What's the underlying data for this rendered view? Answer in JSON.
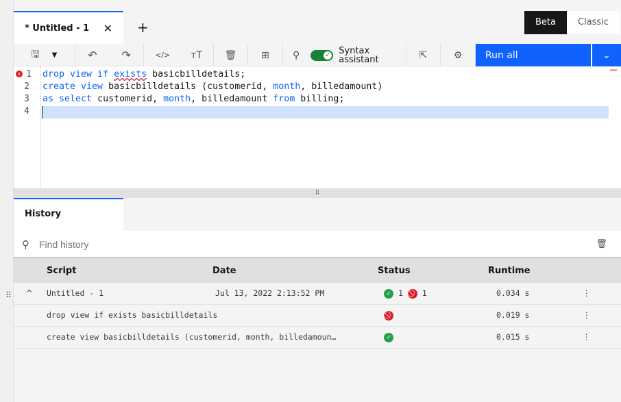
{
  "tabs": {
    "active": "* Untitled - 1"
  },
  "mode": {
    "beta": "Beta",
    "classic": "Classic"
  },
  "toolbar": {
    "syntax": "Syntax assistant",
    "run": "Run all"
  },
  "editor": {
    "lines": [
      "1",
      "2",
      "3",
      "4"
    ]
  },
  "history": {
    "tab": "History",
    "search_placeholder": "Find history",
    "columns": [
      "Script",
      "Date",
      "Status",
      "Runtime"
    ],
    "rows": [
      {
        "script": "Untitled - 1",
        "date": "Jul 13, 2022 2:13:52 PM",
        "ok": "1",
        "fail": "1",
        "runtime": "0.034 s"
      },
      {
        "script": "drop view if exists basicbilldetails",
        "date": "",
        "runtime": "0.019 s",
        "status": "error"
      },
      {
        "script": "create view basicbilldetails (customerid, month, billedamoun…",
        "date": "",
        "runtime": "0.015 s",
        "status": "success"
      }
    ]
  },
  "colors": {
    "accent": "#0f62fe",
    "success": "#24a148",
    "error": "#da1e28"
  }
}
